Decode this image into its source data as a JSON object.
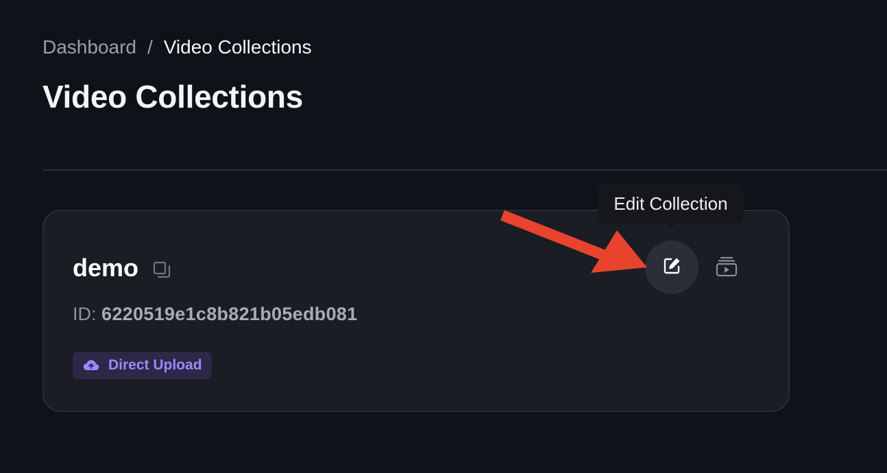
{
  "breadcrumb": {
    "parent": "Dashboard",
    "separator": "/",
    "current": "Video Collections"
  },
  "page": {
    "title": "Video Collections"
  },
  "collection": {
    "name": "demo",
    "id_label": "ID:",
    "id_value": "6220519e1c8b821b05edb081",
    "badge_label": "Direct Upload",
    "badge_icon": "cloud-upload-icon",
    "actions": [
      {
        "name": "edit-collection",
        "icon": "edit-icon"
      },
      {
        "name": "play-collection",
        "icon": "playlist-play-icon"
      }
    ]
  },
  "tooltip": {
    "text": "Edit Collection"
  },
  "colors": {
    "background": "#10121a",
    "card": "#1b1d25",
    "badge_bg": "#2e2748",
    "badge_text": "#9d87ff",
    "annotation_arrow": "#e8432e"
  }
}
